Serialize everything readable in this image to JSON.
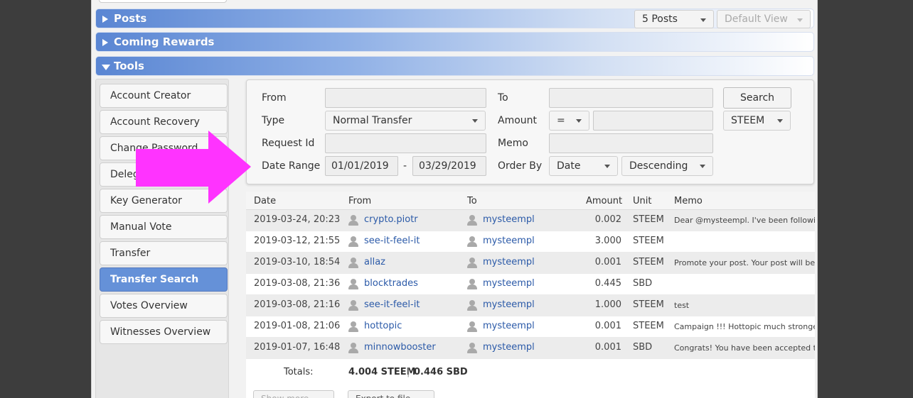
{
  "sections": {
    "posts": {
      "title": "Posts",
      "count_select": "5 Posts",
      "view_select": "Default View"
    },
    "coming_rewards": {
      "title": "Coming Rewards"
    },
    "tools": {
      "title": "Tools"
    }
  },
  "sidebar": {
    "items": [
      {
        "label": "Account Creator"
      },
      {
        "label": "Account Recovery"
      },
      {
        "label": "Change Password"
      },
      {
        "label": "Delegation"
      },
      {
        "label": "Key Generator"
      },
      {
        "label": "Manual Vote"
      },
      {
        "label": "Transfer"
      },
      {
        "label": "Transfer Search",
        "active": true
      },
      {
        "label": "Votes Overview"
      },
      {
        "label": "Witnesses Overview"
      }
    ]
  },
  "form": {
    "from_label": "From",
    "from_value": "",
    "to_label": "To",
    "to_value": "",
    "type_label": "Type",
    "type_value": "Normal Transfer",
    "amount_label": "Amount",
    "amount_op": "=",
    "amount_value": "",
    "currency": "STEEM",
    "request_id_label": "Request Id",
    "request_id_value": "",
    "memo_label": "Memo",
    "memo_value": "",
    "date_range_label": "Date Range",
    "date_from": "01/01/2019",
    "date_sep": "-",
    "date_to": "03/29/2019",
    "order_by_label": "Order By",
    "order_field": "Date",
    "order_dir": "Descending",
    "search_button": "Search"
  },
  "table": {
    "headers": {
      "date": "Date",
      "from": "From",
      "to": "To",
      "amount": "Amount",
      "unit": "Unit",
      "memo": "Memo"
    },
    "rows": [
      {
        "date": "2019-03-24, 20:23",
        "from": "crypto.piotr",
        "to": "mysteempl",
        "amount": "0.002",
        "unit": "STEEM",
        "memo": "Dear @mysteempl. I've been following y"
      },
      {
        "date": "2019-03-12, 21:55",
        "from": "see-it-feel-it",
        "to": "mysteempl",
        "amount": "3.000",
        "unit": "STEEM",
        "memo": ""
      },
      {
        "date": "2019-03-10, 18:54",
        "from": "allaz",
        "to": "mysteempl",
        "amount": "0.001",
        "unit": "STEEM",
        "memo": "Promote your post. Your post will be m"
      },
      {
        "date": "2019-03-08, 21:36",
        "from": "blocktrades",
        "to": "mysteempl",
        "amount": "0.445",
        "unit": "SBD",
        "memo": ""
      },
      {
        "date": "2019-03-08, 21:16",
        "from": "see-it-feel-it",
        "to": "mysteempl",
        "amount": "1.000",
        "unit": "STEEM",
        "memo": "test"
      },
      {
        "date": "2019-01-08, 21:06",
        "from": "hottopic",
        "to": "mysteempl",
        "amount": "0.001",
        "unit": "STEEM",
        "memo": "Campaign !!! Hottopic much stronger no"
      },
      {
        "date": "2019-01-07, 16:48",
        "from": "minnowbooster",
        "to": "mysteempl",
        "amount": "0.001",
        "unit": "SBD",
        "memo": "Congrats! You have been accepted to th"
      }
    ],
    "totals_label": "Totals:",
    "totals_steem": "4.004 STEEM",
    "totals_sep": "|",
    "totals_sbd": "0.446 SBD"
  },
  "bottom": {
    "left_button": "Show more",
    "right_button": "Export to file"
  },
  "colors": {
    "section_bar": "#5a86d3",
    "active_item": "#6591d8",
    "arrow": "#ff33ff",
    "link": "#2b5aa8"
  }
}
